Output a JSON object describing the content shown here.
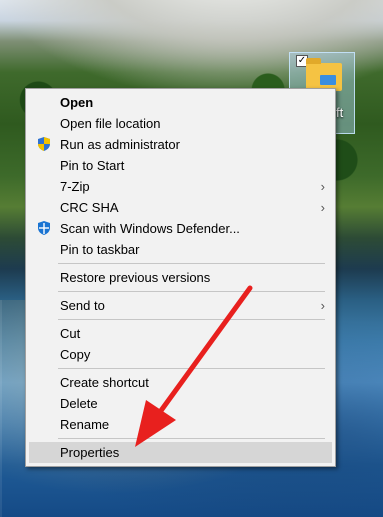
{
  "desktop": {
    "icon": {
      "label_fragment": "ft",
      "checkbox_mark": "✓",
      "icon_name": "folder-icon"
    }
  },
  "context_menu": {
    "items": [
      {
        "label": "Open",
        "bold": true
      },
      {
        "label": "Open file location"
      },
      {
        "label": "Run as administrator",
        "icon": "uac-shield-icon"
      },
      {
        "label": "Pin to Start"
      },
      {
        "label": "7-Zip",
        "submenu": true
      },
      {
        "label": "CRC SHA",
        "submenu": true
      },
      {
        "label": "Scan with Windows Defender...",
        "icon": "windows-defender-icon"
      },
      {
        "label": "Pin to taskbar"
      },
      {
        "label": "Restore previous versions"
      },
      {
        "label": "Send to",
        "submenu": true
      },
      {
        "label": "Cut"
      },
      {
        "label": "Copy"
      },
      {
        "label": "Create shortcut"
      },
      {
        "label": "Delete"
      },
      {
        "label": "Rename"
      },
      {
        "label": "Properties",
        "highlighted": true
      }
    ],
    "submenu_glyph": "›"
  },
  "annotation": {
    "color": "#e8201e",
    "icon_name": "red-arrow-pointer"
  },
  "colors": {
    "menu_background": "#f2f2f2",
    "menu_highlight": "#d6d6d6",
    "separator": "#c6c6c6",
    "uac_shield_blue": "#2f72d0",
    "uac_shield_yellow": "#f2c200",
    "defender_blue": "#1a74d2"
  }
}
